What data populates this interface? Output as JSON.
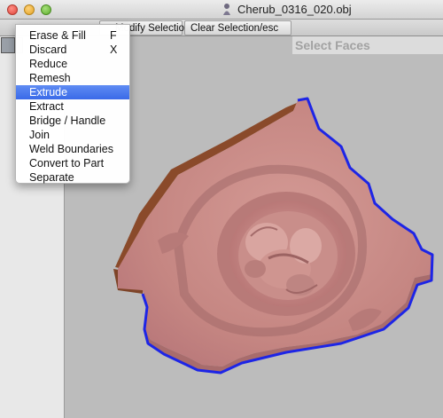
{
  "window": {
    "title": "Cherub_0316_020.obj"
  },
  "toolbar": {
    "modify_selection_label": "Modify Selection",
    "clear_selection_label": "Clear Selection/esc"
  },
  "panel": {
    "header": "Select Faces"
  },
  "menu": {
    "items": [
      {
        "label": "Erase & Fill",
        "shortcut": "F"
      },
      {
        "label": "Discard",
        "shortcut": "X"
      },
      {
        "label": "Reduce",
        "shortcut": ""
      },
      {
        "label": "Remesh",
        "shortcut": ""
      },
      {
        "label": "Extrude",
        "shortcut": ""
      },
      {
        "label": "Extract",
        "shortcut": ""
      },
      {
        "label": "Bridge / Handle",
        "shortcut": ""
      },
      {
        "label": "Join",
        "shortcut": ""
      },
      {
        "label": "Weld Boundaries",
        "shortcut": ""
      },
      {
        "label": "Convert to Part",
        "shortcut": ""
      },
      {
        "label": "Separate",
        "shortcut": ""
      }
    ],
    "highlighted_index": 4
  },
  "colors": {
    "model_surface": "#c98a86",
    "model_side": "#8a4a2a",
    "selection_boundary": "#1d25e6",
    "menu_highlight": "#3a6ae8",
    "viewport_bg": "#bcbcbc"
  },
  "icons": {
    "document_icon": "cherub-object-icon",
    "tool_thumbnail": "face-select-tool-icon"
  }
}
